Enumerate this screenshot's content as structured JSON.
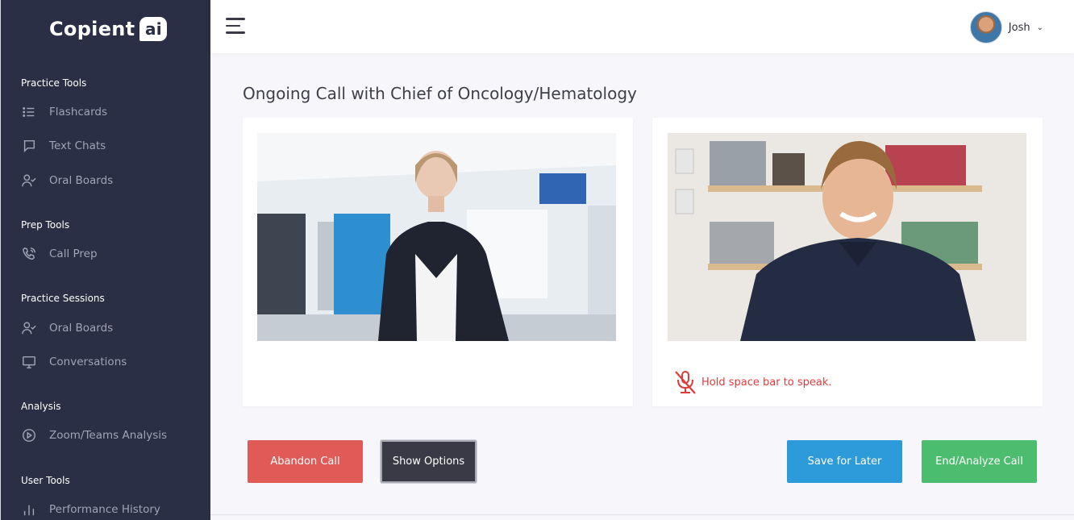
{
  "app": {
    "logo_text": "Copient",
    "logo_badge": "ai"
  },
  "sidebar": {
    "sections": [
      {
        "title": "Practice Tools",
        "items": [
          {
            "label": "Flashcards",
            "icon": "list-icon"
          },
          {
            "label": "Text Chats",
            "icon": "chat-icon"
          },
          {
            "label": "Oral Boards",
            "icon": "user-check-icon"
          }
        ]
      },
      {
        "title": "Prep Tools",
        "items": [
          {
            "label": "Call Prep",
            "icon": "phone-call-icon"
          }
        ]
      },
      {
        "title": "Practice Sessions",
        "items": [
          {
            "label": "Oral Boards",
            "icon": "user-check-icon"
          },
          {
            "label": "Conversations",
            "icon": "monitor-icon"
          }
        ]
      },
      {
        "title": "Analysis",
        "items": [
          {
            "label": "Zoom/Teams Analysis",
            "icon": "play-circle-icon"
          }
        ]
      },
      {
        "title": "User Tools",
        "items": [
          {
            "label": "Performance History",
            "icon": "bar-chart-icon"
          }
        ]
      }
    ]
  },
  "header": {
    "user_name": "Josh"
  },
  "main": {
    "title": "Ongoing Call with Chief of Oncology/Hematology",
    "mute_hint": "Hold space bar to speak."
  },
  "buttons": {
    "abandon": "Abandon Call",
    "options": "Show Options",
    "save": "Save for Later",
    "end": "End/Analyze Call"
  },
  "colors": {
    "sidebar_bg": "#2a2f45",
    "abandon": "#e05a57",
    "options": "#3a3a46",
    "save": "#2d9ad9",
    "end": "#4cbc6e",
    "mute_red": "#e03b3b"
  }
}
